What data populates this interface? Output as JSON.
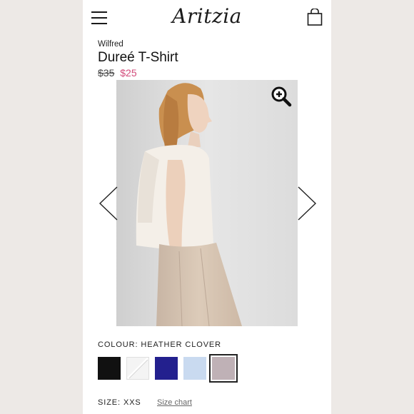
{
  "header": {
    "logo_text": "Aritzia",
    "menu_icon": "hamburger-menu-icon",
    "bag_icon": "shopping-bag-icon"
  },
  "product": {
    "brand": "Wilfred",
    "name": "Dureé T-Shirt",
    "price_original": "$35",
    "price_sale": "$25",
    "sale_color": "#d24b7a"
  },
  "gallery": {
    "zoom_icon": "zoom-in-icon",
    "prev_icon": "chevron-left-icon",
    "next_icon": "chevron-right-icon"
  },
  "colour": {
    "label": "COLOUR: HEATHER CLOVER",
    "swatches": [
      {
        "name": "black",
        "color": "#111111"
      },
      {
        "name": "white",
        "color": "#f4f4f4"
      },
      {
        "name": "navy",
        "color": "#23208e"
      },
      {
        "name": "light-blue",
        "color": "#c9daf0"
      },
      {
        "name": "heather-clover",
        "color": "#bfb1b6",
        "selected": true
      }
    ]
  },
  "size": {
    "label": "SIZE: XXS",
    "chart_link": "Size chart"
  }
}
